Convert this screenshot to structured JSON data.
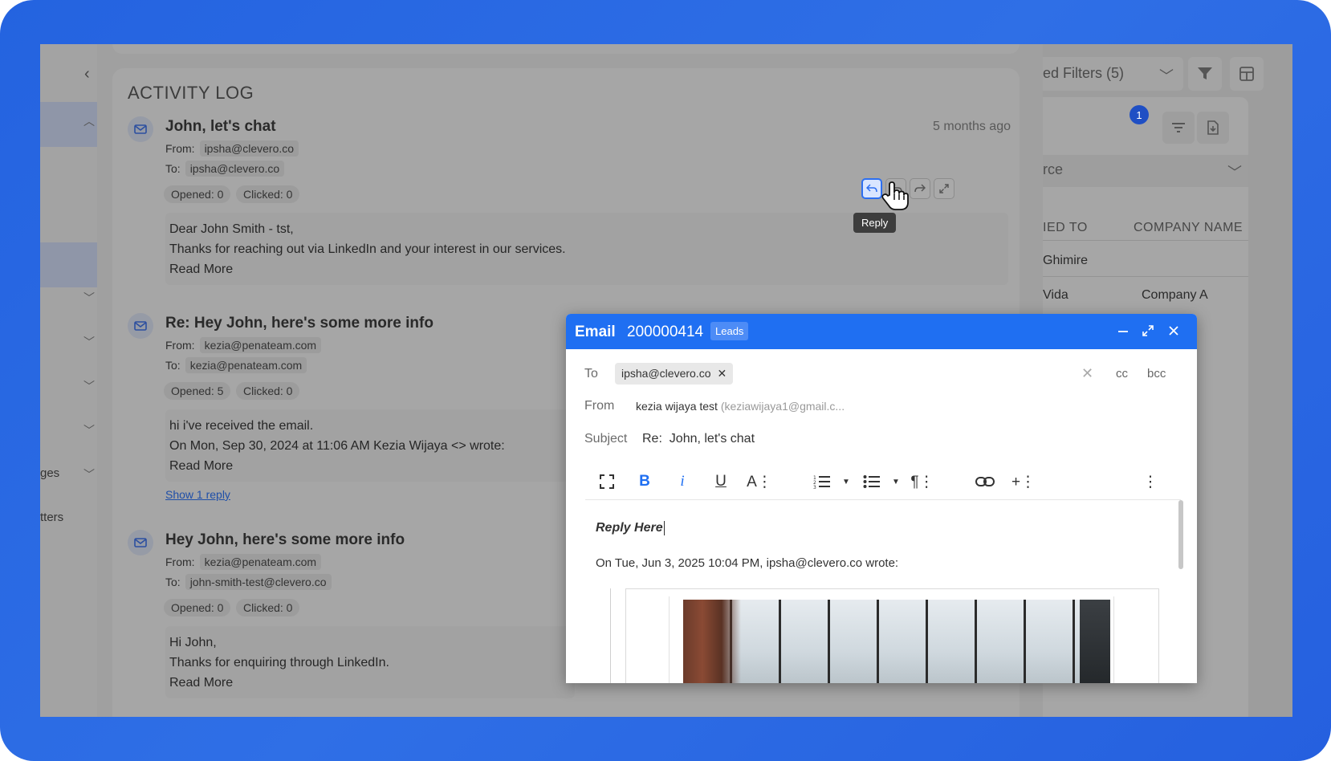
{
  "activity_log": {
    "title": "ACTIVITY LOG",
    "entries": [
      {
        "subject": "John, let's chat",
        "time": "5 months ago",
        "from_label": "From:",
        "from": "ipsha@clevero.co",
        "to_label": "To:",
        "to": "ipsha@clevero.co",
        "opened": "Opened: 0",
        "clicked": "Clicked: 0",
        "body": [
          "Dear John Smith - tst,",
          "Thanks for reaching out via LinkedIn and your interest in our services.",
          "Read More"
        ]
      },
      {
        "subject": "Re: Hey John, here's some more info",
        "from_label": "From:",
        "from": "kezia@penateam.com",
        "to_label": "To:",
        "to": "kezia@penateam.com",
        "opened": "Opened: 5",
        "clicked": "Clicked: 0",
        "body": [
          "hi i've received the email.",
          "On Mon, Sep 30, 2024 at 11:06 AM Kezia Wijaya <> wrote:",
          "Read More"
        ],
        "show_reply": "Show 1 reply"
      },
      {
        "subject": "Hey John, here's some more info",
        "from_label": "From:",
        "from": "kezia@penateam.com",
        "to_label": "To:",
        "to": "john-smith-test@clevero.co",
        "opened": "Opened: 0",
        "clicked": "Clicked: 0",
        "body": [
          "Hi John,",
          "Thanks for enquiring through LinkedIn.",
          "Read More"
        ]
      }
    ],
    "tooltip": "Reply"
  },
  "sidebar": {
    "partial_labels": [
      "ges",
      "tters"
    ]
  },
  "right_panel": {
    "filter_label": "ed Filters (5)",
    "badge_count": "1",
    "select_partial": "rce",
    "columns": [
      "IED TO",
      "COMPANY NAME"
    ],
    "rows": [
      {
        "assigned": "Ghimire",
        "company": ""
      },
      {
        "assigned": "Vida",
        "company": "Company A"
      }
    ]
  },
  "composer": {
    "title": "Email",
    "record_number": "200000414",
    "tag": "Leads",
    "to_label": "To",
    "to_chip": "ipsha@clevero.co",
    "cc": "cc",
    "bcc": "bcc",
    "from_label": "From",
    "from_name": "kezia wijaya test",
    "from_email": "(keziawijaya1@gmail.c...",
    "subject_label": "Subject",
    "subject_value": "Re:  John, let's chat",
    "editor_text": "Reply Here",
    "quote_header": "On Tue, Jun 3, 2025 10:04 PM, ipsha@clevero.co wrote:",
    "toolbar_icons": [
      "fullscreen-icon",
      "bold-icon",
      "italic-icon",
      "underline-icon",
      "font-size-icon",
      "ordered-list-icon",
      "unordered-list-icon",
      "paragraph-icon",
      "link-icon",
      "insert-icon",
      "more-icon"
    ]
  },
  "colors": {
    "frame": "#2463e0",
    "composer_header": "#1f6ff2",
    "link": "#1f4fa8"
  }
}
